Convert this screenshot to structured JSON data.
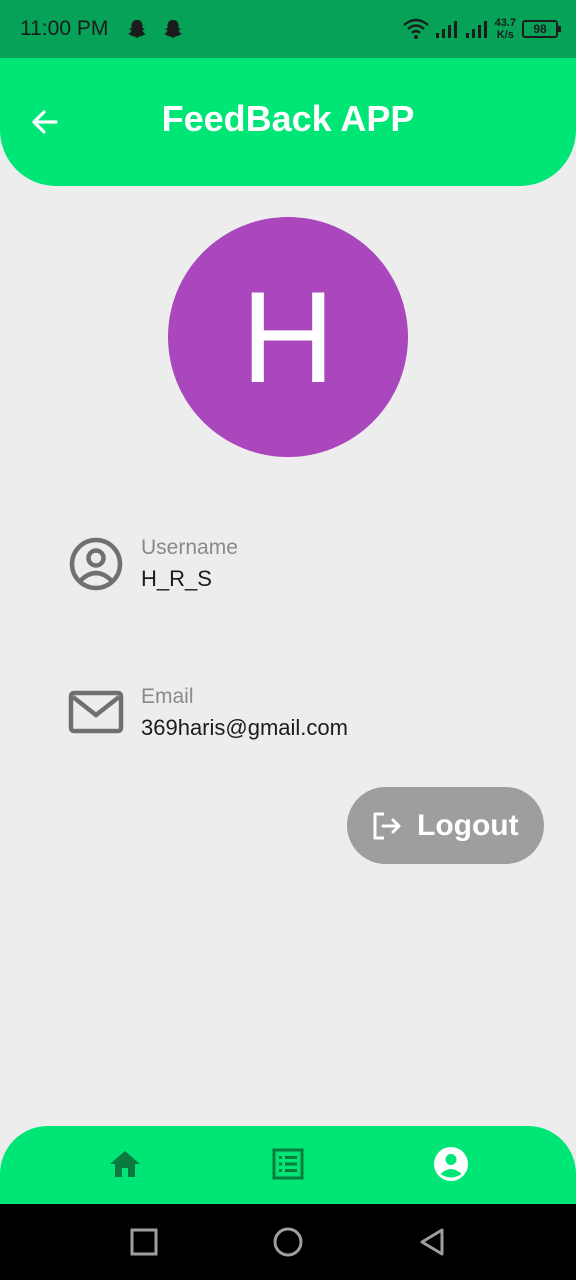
{
  "status_bar": {
    "time": "11:00 PM",
    "speed_value": "43.7",
    "speed_unit": "K/s",
    "battery": "98"
  },
  "app_bar": {
    "title": "FeedBack APP"
  },
  "profile": {
    "avatar_initial": "H",
    "avatar_color": "#ab47bc",
    "username_label": "Username",
    "username_value": "H_R_S",
    "email_label": "Email",
    "email_value": "369haris@gmail.com"
  },
  "actions": {
    "logout_label": "Logout"
  },
  "bottom_nav": {
    "items": [
      {
        "icon": "home-icon",
        "active": false
      },
      {
        "icon": "list-icon",
        "active": false
      },
      {
        "icon": "account-circle-icon",
        "active": true
      }
    ]
  },
  "colors": {
    "status_bar": "#05a257",
    "accent": "#00e676",
    "nav_inactive": "#0a7a3e",
    "nav_active": "#ffffff",
    "logout_button": "#9e9e9e",
    "background": "#ededed"
  }
}
